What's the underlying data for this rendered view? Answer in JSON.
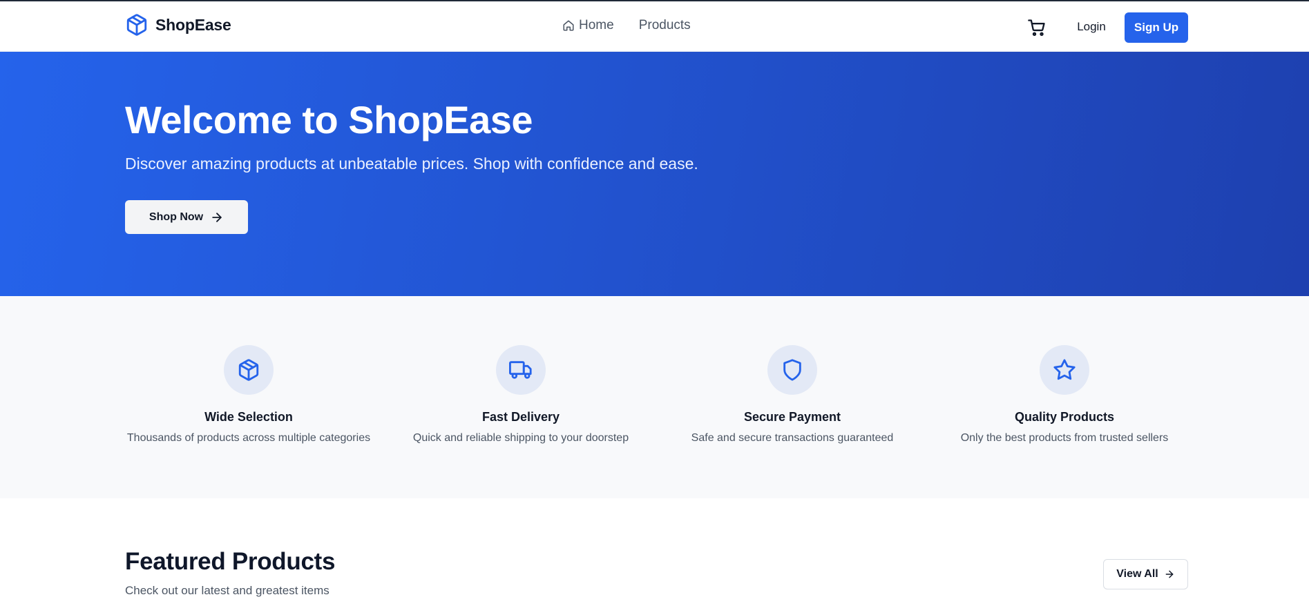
{
  "header": {
    "brand": "ShopEase",
    "brand_icon": "package-icon",
    "nav": [
      {
        "label": "Home",
        "icon": "home-icon"
      },
      {
        "label": "Products"
      }
    ],
    "cart_icon": "shopping-cart-icon",
    "login_label": "Login",
    "signup_label": "Sign Up"
  },
  "hero": {
    "title": "Welcome to ShopEase",
    "subtitle": "Discover amazing products at unbeatable prices. Shop with confidence and ease.",
    "cta_label": "Shop Now",
    "cta_icon": "arrow-right-icon"
  },
  "features": [
    {
      "icon": "package-icon",
      "title": "Wide Selection",
      "desc": "Thousands of products across multiple categories"
    },
    {
      "icon": "truck-icon",
      "title": "Fast Delivery",
      "desc": "Quick and reliable shipping to your doorstep"
    },
    {
      "icon": "shield-icon",
      "title": "Secure Payment",
      "desc": "Safe and secure transactions guaranteed"
    },
    {
      "icon": "star-icon",
      "title": "Quality Products",
      "desc": "Only the best products from trusted sellers"
    }
  ],
  "featured": {
    "title": "Featured Products",
    "subtitle": "Check out our latest and greatest items",
    "view_all_label": "View All"
  },
  "colors": {
    "primary": "#2563eb",
    "hero_end": "#1e40af",
    "feature_bg": "#f8f9fb",
    "icon_circle": "#e3e9f6"
  }
}
